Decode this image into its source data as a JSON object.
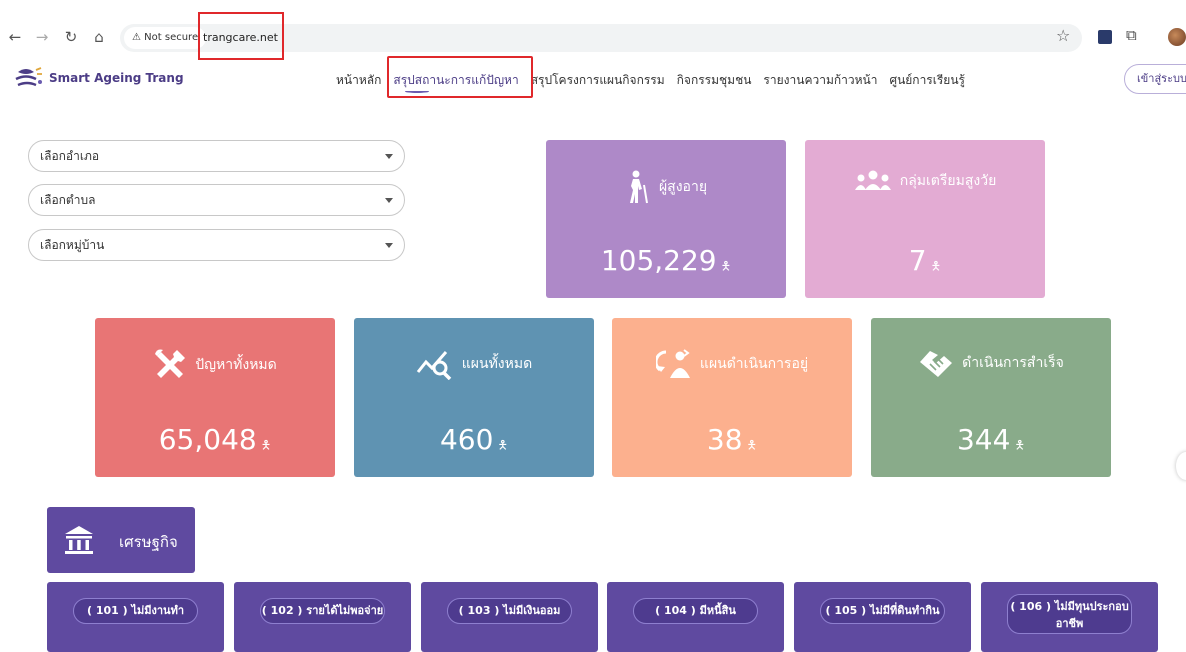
{
  "browser": {
    "security": "Not secure",
    "url": "trangcare.net"
  },
  "site": {
    "title": "Smart Ageing Trang",
    "menu": [
      "หน้าหลัก",
      "สรุปสถานะการแก้ปัญหา",
      "สรุปโครงการแผนกิจกรรม",
      "กิจกรรมชุมชน",
      "รายงานความก้าวหน้า",
      "ศูนย์การเรียนรู้"
    ],
    "login": "เข้าสู่ระบบ"
  },
  "filters": {
    "district": "เลือกอำเภอ",
    "subdistrict": "เลือกตำบล",
    "village": "เลือกหมู่บ้าน"
  },
  "stats": {
    "elderly": {
      "label": "ผู้สูงอายุ",
      "value": "105,229"
    },
    "preparing": {
      "label": "กลุ่มเตรียมสูงวัย",
      "value": "7"
    },
    "problems": {
      "label": "ปัญหาทั้งหมด",
      "value": "65,048"
    },
    "plans": {
      "label": "แผนทั้งหมด",
      "value": "460"
    },
    "in_progress": {
      "label": "แผนดำเนินการอยู่",
      "value": "38"
    },
    "completed": {
      "label": "ดำเนินการสำเร็จ",
      "value": "344"
    }
  },
  "category": {
    "title": "เศรษฐกิจ",
    "items": [
      "( 101 ) ไม่มีงานทำ",
      "( 102 ) รายได้ไม่พอจ่าย",
      "( 103 ) ไม่มีเงินออม",
      "( 104 ) มีหนี้สิน",
      "( 105 ) ไม่มีที่ดินทำกิน",
      "( 106 ) ไม่มีทุนประกอบอาชีพ"
    ]
  },
  "colors": {
    "brand": "#4c3d86",
    "elderly": "#ae89c8",
    "preparing": "#e3abd3",
    "problems": "#e87575",
    "plans": "#5f93b2",
    "in_progress": "#fcb08e",
    "completed": "#89ab8a",
    "category": "#5f4aa0",
    "highlight": "#e0282b"
  }
}
